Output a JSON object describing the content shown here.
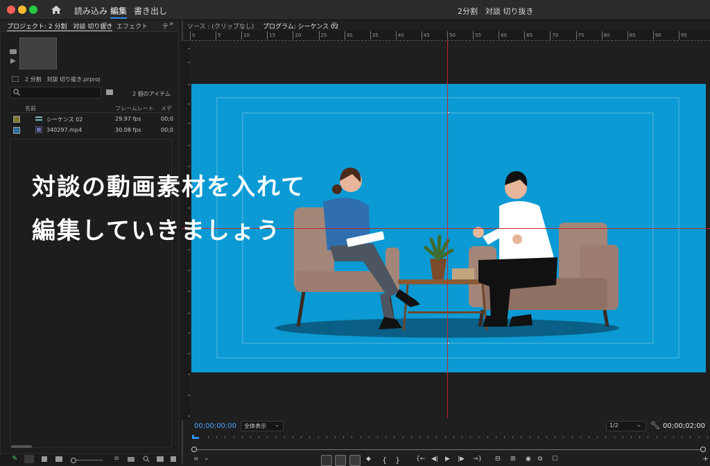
{
  "window": {
    "title": "2分割　対談 切り抜き",
    "menus": [
      "読み込み",
      "編集",
      "書き出し"
    ],
    "active_menu": "編集"
  },
  "project_panel": {
    "tabs": [
      "プロジェクト: 2 分割　対談 切り抜き",
      "エフェクト",
      "テ"
    ],
    "file_name": "2 分割　対談 切り抜き.prproj",
    "item_count": "2 個のアイテム",
    "search_placeholder": "",
    "columns": [
      "名前",
      "フレームレート",
      "メデ"
    ],
    "rows": [
      {
        "name": "シーケンス 02",
        "fps": "29.97 fps",
        "media": "00;0",
        "swatch": "#7a7a2a"
      },
      {
        "name": "340297.mp4",
        "fps": "30.08 fps",
        "media": "00;0",
        "swatch": "#2a6f9e"
      }
    ]
  },
  "monitor": {
    "source_tab": "ソース : (クリップなし)",
    "program_tab": "プログラム: シーケンス 02",
    "ruler_ticks": [
      "0",
      "5",
      "10",
      "15",
      "20",
      "25",
      "30",
      "35",
      "40",
      "45",
      "50",
      "55",
      "60",
      "65",
      "70",
      "75",
      "80",
      "85",
      "90",
      "95"
    ],
    "timecode_left": "00;00;00;00",
    "zoom": "全体表示",
    "resolution": "1/2",
    "timecode_right": "00;00;02;00",
    "overlay_line1": "対談の動画素材を入れて",
    "overlay_line2": "編集していきましょう"
  },
  "colors": {
    "accent": "#2d8ceb",
    "timecode": "#4aa3ff",
    "video_bg": "#0b9ad3",
    "guide_red": "#c0272d"
  }
}
